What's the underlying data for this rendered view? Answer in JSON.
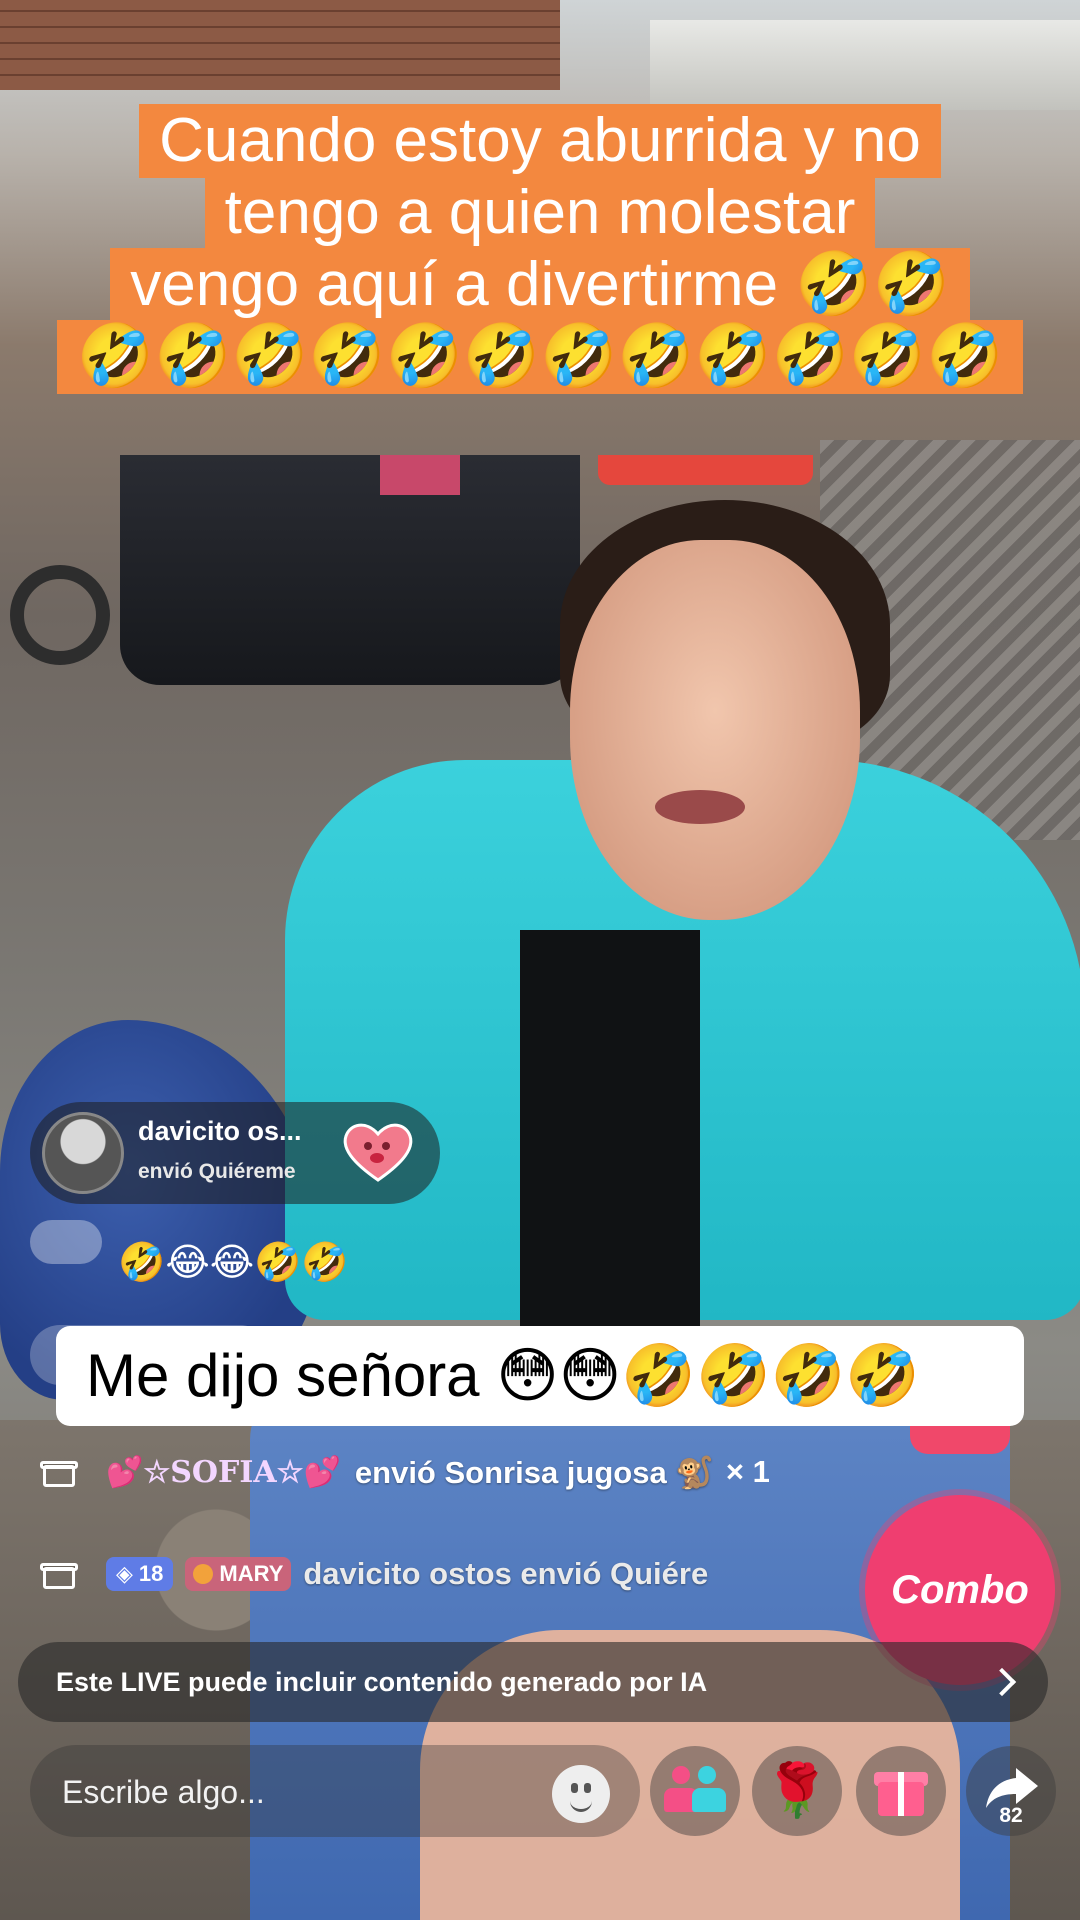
{
  "caption": {
    "lines": [
      "Cuando estoy aburrida y no",
      "tengo a quien molestar",
      "vengo aquí a divertirme 🤣🤣",
      "🤣🤣🤣🤣🤣🤣🤣🤣🤣🤣🤣🤣"
    ],
    "bg_color": "#f3883f"
  },
  "gift_notification": {
    "user": "davicito os...",
    "action": "envió Quiéreme",
    "gift_icon": "heart-face-gift-icon"
  },
  "emoji_comment": "🤣😂😂🤣🤣",
  "caption2": {
    "text": "Me dijo señora 😳😳🤣🤣🤣🤣"
  },
  "feed": [
    {
      "icon": "gift-box-icon",
      "name": "💕☆SOFIA☆💕",
      "text": "envió Sonrisa jugosa 🐒",
      "count": "× 1"
    },
    {
      "icon": "gift-box-icon",
      "level": "18",
      "badge": "MARY",
      "text": "davicito ostos envió Quiére"
    }
  ],
  "combo_label": "Combo",
  "ai_notice": "Este LIVE puede incluir contenido generado por IA",
  "compose": {
    "placeholder": "Escribe algo..."
  },
  "share_count": "82",
  "colors": {
    "accent_pink": "#ef3e70",
    "level_badge": "#5f7ce6",
    "mary_badge": "#c9647a"
  }
}
